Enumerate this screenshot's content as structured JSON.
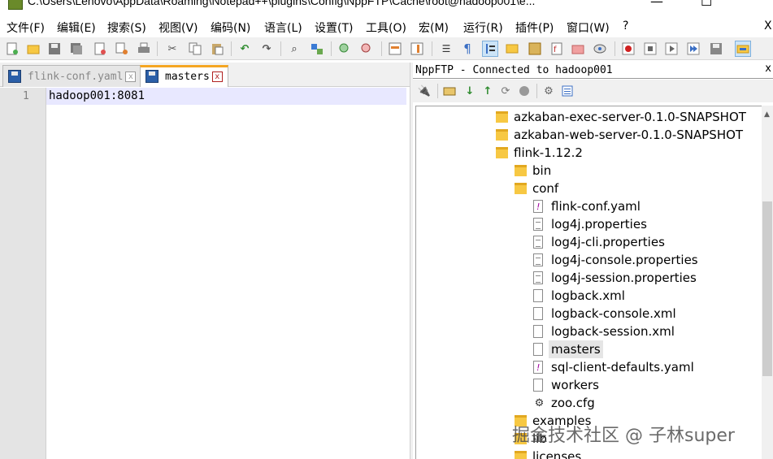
{
  "window": {
    "title": "C:\\Users\\Lenovo\\AppData\\Roaming\\Notepad++\\plugins\\Config\\NppFTP\\Cache\\root@hadoop001\\e...",
    "minimize": "—",
    "maximize": "☐"
  },
  "menu": [
    "文件(F)",
    "编辑(E)",
    "搜索(S)",
    "视图(V)",
    "编码(N)",
    "语言(L)",
    "设置(T)",
    "工具(O)",
    "宏(M)",
    "运行(R)",
    "插件(P)",
    "窗口(W)",
    "?"
  ],
  "menu_close": "X",
  "toolbar": {
    "icons": [
      "new-file-icon",
      "open-file-icon",
      "save-icon",
      "save-all-icon",
      "close-icon",
      "close-all-icon",
      "print-icon",
      "cut-icon",
      "copy-icon",
      "paste-icon",
      "undo-icon",
      "redo-icon",
      "find-icon",
      "replace-icon",
      "zoom-in-icon",
      "zoom-out-icon",
      "sync-vertical-icon",
      "sync-horizontal-icon",
      "word-wrap-icon",
      "show-all-chars-icon",
      "indent-guide-icon",
      "udl-icon",
      "doc-map-icon",
      "function-list-icon",
      "folder-workspace-icon",
      "monitor-icon",
      "record-macro-icon",
      "stop-macro-icon",
      "play-macro-icon",
      "run-macro-icon",
      "save-macro-icon",
      "nppftp-icon"
    ]
  },
  "tabs": [
    {
      "label": "flink-conf.yaml",
      "active": false,
      "close": "x"
    },
    {
      "label": "masters",
      "active": true,
      "close": "x"
    }
  ],
  "editor": {
    "line_numbers": [
      "1"
    ],
    "lines": [
      "hadoop001:8081"
    ]
  },
  "ftp": {
    "title": "NppFTP - Connected to hadoop001",
    "close": "x",
    "tool_icons": [
      "connect-icon",
      "open-folder-icon",
      "download-icon",
      "upload-icon",
      "refresh-icon",
      "abort-icon",
      "settings-icon",
      "queue-icon"
    ],
    "tree": [
      {
        "label": "azkaban-exec-server-0.1.0-SNAPSHOT",
        "type": "folder",
        "level": 0
      },
      {
        "label": "azkaban-web-server-0.1.0-SNAPSHOT",
        "type": "folder",
        "level": 0
      },
      {
        "label": "flink-1.12.2",
        "type": "folder",
        "level": 0
      },
      {
        "label": "bin",
        "type": "folder",
        "level": 1
      },
      {
        "label": "conf",
        "type": "folder",
        "level": 1
      },
      {
        "label": "flink-conf.yaml",
        "type": "file-warn",
        "level": 2
      },
      {
        "label": "log4j.properties",
        "type": "file-lines",
        "level": 2
      },
      {
        "label": "log4j-cli.properties",
        "type": "file-lines",
        "level": 2
      },
      {
        "label": "log4j-console.properties",
        "type": "file-lines",
        "level": 2
      },
      {
        "label": "log4j-session.properties",
        "type": "file-lines",
        "level": 2
      },
      {
        "label": "logback.xml",
        "type": "file",
        "level": 2
      },
      {
        "label": "logback-console.xml",
        "type": "file",
        "level": 2
      },
      {
        "label": "logback-session.xml",
        "type": "file",
        "level": 2
      },
      {
        "label": "masters",
        "type": "file",
        "level": 2,
        "selected": true
      },
      {
        "label": "sql-client-defaults.yaml",
        "type": "file-warn",
        "level": 2
      },
      {
        "label": "workers",
        "type": "file",
        "level": 2
      },
      {
        "label": "zoo.cfg",
        "type": "gear",
        "level": 2
      },
      {
        "label": "examples",
        "type": "folder",
        "level": 1
      },
      {
        "label": "lib",
        "type": "folder",
        "level": 1
      },
      {
        "label": "licenses",
        "type": "folder",
        "level": 1
      }
    ]
  },
  "watermark": "掘金技术社区 @ 子林super"
}
